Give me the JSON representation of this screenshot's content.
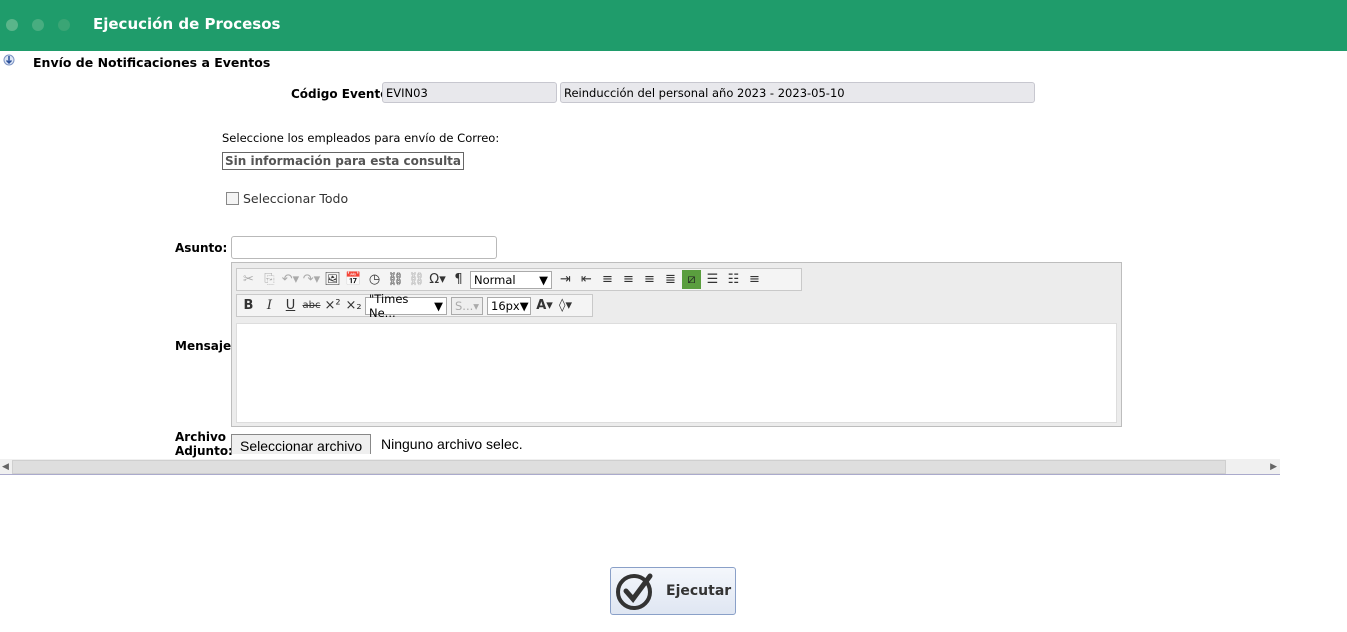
{
  "header": {
    "title": "Ejecución de Procesos"
  },
  "section": {
    "title": "Envío de Notificaciones a Eventos"
  },
  "codigo": {
    "label": "Código Evento:",
    "code": "EVIN03",
    "description": "Reinducción del personal año 2023 - 2023-05-10"
  },
  "empleados": {
    "label": "Seleccione los empleados para envío de Correo:",
    "empty_message": "Sin información para esta consulta",
    "select_all_label": "Seleccionar Todo"
  },
  "asunto": {
    "label": "Asunto:",
    "value": ""
  },
  "mensaje": {
    "label": "Mensaje:",
    "format_value": "Normal",
    "font_value": "\"Times Ne...",
    "size_value": "S...",
    "fontsize_value": "16px"
  },
  "archivo": {
    "label_line1": "Archivo",
    "label_line2": "Adjunto:",
    "button_label": "Seleccionar archivo",
    "status": "Ninguno archivo selec."
  },
  "actions": {
    "execute_label": "Ejecutar"
  },
  "colors": {
    "header_bg": "#1f9c6b"
  }
}
